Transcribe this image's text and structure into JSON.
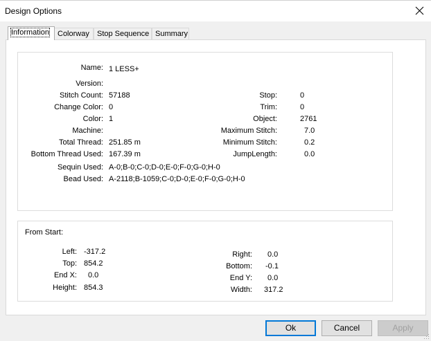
{
  "window": {
    "title": "Design Options"
  },
  "tabs": [
    {
      "label": "Information"
    },
    {
      "label": "Colorway"
    },
    {
      "label": "Stop Sequence"
    },
    {
      "label": "Summary"
    }
  ],
  "info": {
    "name_label": "Name:",
    "name": "1 LESS+",
    "version_label": "Version:",
    "version": "",
    "stitch_count_label": "Stitch Count:",
    "stitch_count": "57188",
    "change_color_label": "Change Color:",
    "change_color": "0",
    "color_label": "Color:",
    "color": "1",
    "machine_label": "Machine:",
    "machine": "",
    "total_thread_label": "Total Thread:",
    "total_thread": "251.85 m",
    "bottom_thread_label": "Bottom Thread Used:",
    "bottom_thread": "167.39 m",
    "sequin_label": "Sequin Used:",
    "sequin": "A-0;B-0;C-0;D-0;E-0;F-0;G-0;H-0",
    "bead_label": "Bead Used:",
    "bead": "A-2118;B-1059;C-0;D-0;E-0;F-0;G-0;H-0",
    "stop_label": "Stop:",
    "stop": "0",
    "trim_label": "Trim:",
    "trim": "0",
    "object_label": "Object:",
    "object": "2761",
    "max_stitch_label": "Maximum Stitch:",
    "max_stitch": "7.0",
    "min_stitch_label": "Minimum Stitch:",
    "min_stitch": "0.2",
    "jump_label": "JumpLength:",
    "jump": "0.0"
  },
  "from_start": {
    "heading": "From Start:",
    "left_label": "Left:",
    "left": "-317.2",
    "top_label": "Top:",
    "top": "854.2",
    "endx_label": "End X:",
    "endx": "0.0",
    "height_label": "Height:",
    "height": "854.3",
    "right_label": "Right:",
    "right": "0.0",
    "bottom_label": "Bottom:",
    "bottom": "-0.1",
    "endy_label": "End Y:",
    "endy": "0.0",
    "width_label": "Width:",
    "width": "317.2"
  },
  "buttons": {
    "ok": "Ok",
    "cancel": "Cancel",
    "apply": "Apply"
  }
}
